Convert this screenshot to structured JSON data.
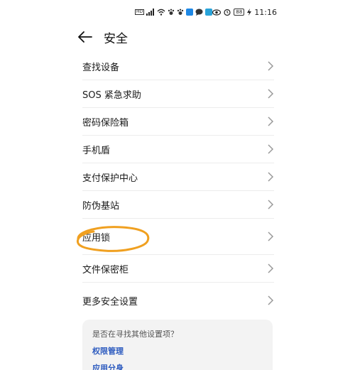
{
  "status_bar": {
    "time": "11:16",
    "battery_label": "88",
    "icons": [
      "hd-icon",
      "signal-icon",
      "wifi-icon",
      "paw-icon",
      "paw-icon",
      "app-notification-icon",
      "chat-icon",
      "app-notification-icon",
      "eye-icon",
      "alarm-icon",
      "battery-icon",
      "charging-icon"
    ]
  },
  "header": {
    "title": "安全"
  },
  "list": {
    "items": [
      {
        "label": "查找设备"
      },
      {
        "label": "SOS 紧急求助"
      },
      {
        "label": "密码保险箱"
      },
      {
        "label": "手机盾"
      },
      {
        "label": "支付保护中心"
      },
      {
        "label": "防伪基站"
      },
      {
        "label": "应用锁"
      },
      {
        "label": "文件保密柜"
      },
      {
        "label": "更多安全设置"
      }
    ]
  },
  "suggest": {
    "question": "是否在寻找其他设置项？",
    "links": [
      "权限管理",
      "应用分身"
    ]
  },
  "colors": {
    "accent_link": "#2d5bbf",
    "highlight": "#f0a020"
  }
}
